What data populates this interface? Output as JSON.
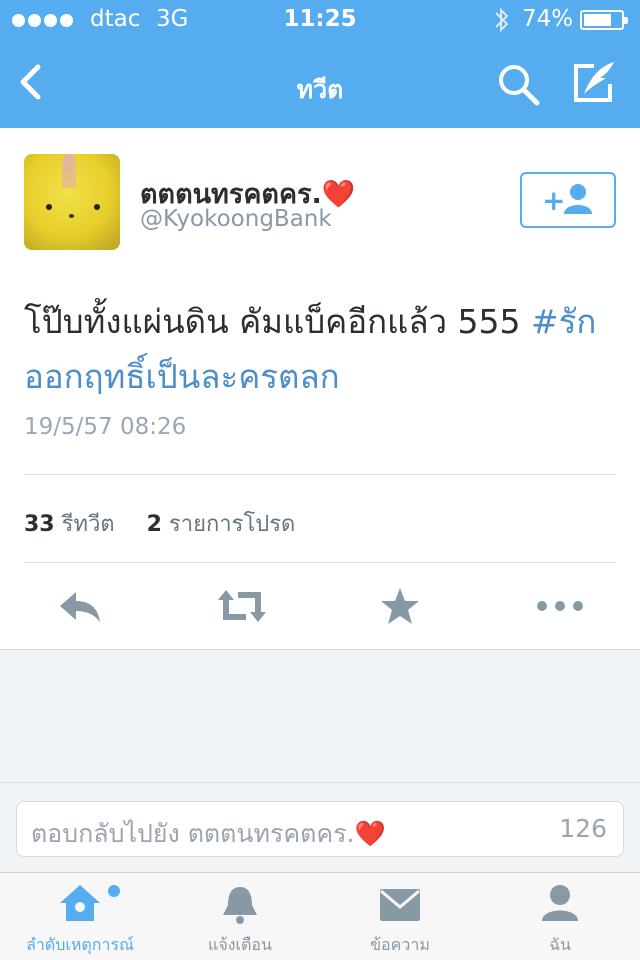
{
  "status_bar": {
    "signal_bars_filled": 4,
    "signal_bars_total": 5,
    "carrier": "dtac",
    "network": "3G",
    "time": "11:25",
    "battery_percent": "74%",
    "battery_level": 0.74,
    "bluetooth_icon": "bluetooth-icon"
  },
  "nav": {
    "title": "ทวีต",
    "back_icon": "chevron-left-icon",
    "search_icon": "search-icon",
    "compose_icon": "compose-icon"
  },
  "tweet": {
    "author_name": "ตตตนทรคตคร.",
    "author_emoji": "❤️",
    "author_handle": "@KyokoongBank",
    "text_main": "โป๊บทั้งแผ่นดิน คัมแบ็คอีกแล้ว 555 ",
    "hashtag": "#รักออกฤทธิ์เป็นละครตลก",
    "timestamp": "19/5/57 08:26",
    "retweet_count": "33",
    "retweet_label": "รีทวีต",
    "favorite_count": "2",
    "favorite_label": "รายการโปรด",
    "follow_icon": "add-user-icon",
    "actions": [
      {
        "name": "reply",
        "icon": "reply-icon"
      },
      {
        "name": "retweet",
        "icon": "retweet-icon"
      },
      {
        "name": "favorite",
        "icon": "star-icon"
      },
      {
        "name": "more",
        "icon": "more-icon"
      }
    ]
  },
  "reply": {
    "placeholder": "ตอบกลับไปยัง ตตตนทรคตคร.",
    "emoji": "❤️",
    "char_count": "126"
  },
  "tabs": [
    {
      "label": "ลำดับเหตุการณ์",
      "icon": "home-icon",
      "active": true
    },
    {
      "label": "แจ้งเตือน",
      "icon": "bell-icon",
      "active": false
    },
    {
      "label": "ข้อความ",
      "icon": "mail-icon",
      "active": false
    },
    {
      "label": "ฉัน",
      "icon": "profile-icon",
      "active": false
    }
  ],
  "colors": {
    "brand": "#55acee",
    "icon_gray": "#8899a6",
    "hashtag": "#4b8ec9"
  }
}
